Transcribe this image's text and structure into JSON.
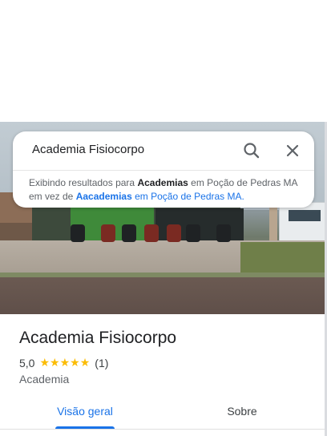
{
  "search": {
    "query": "Academia Fisiocorpo",
    "notice_prefix": "Exibindo resultados para",
    "notice_corrected": "Academias",
    "notice_middle": "em Poção de Pedras MA em vez de",
    "notice_original": "Aacademias",
    "notice_suffix": "em Poção de Pedras MA."
  },
  "place": {
    "title": "Academia Fisiocorpo",
    "rating": "5,0",
    "stars": [
      "★",
      "★",
      "★",
      "★",
      "★"
    ],
    "review_count": "(1)",
    "category": "Academia"
  },
  "tabs": {
    "overview": "Visão geral",
    "about": "Sobre"
  },
  "colors": {
    "accent": "#1a73e8",
    "star": "#fbbc04"
  },
  "icons": {
    "search": "search-icon",
    "close": "close-icon"
  }
}
